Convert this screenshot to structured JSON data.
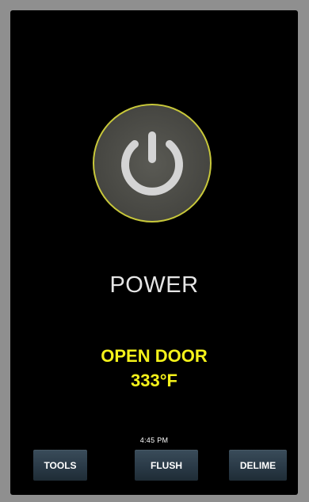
{
  "power": {
    "label": "POWER",
    "icon": "power-icon",
    "ring_color": "#c8c83a"
  },
  "status": {
    "door": "OPEN DOOR",
    "temperature": "333°F",
    "color": "#f4f21a"
  },
  "clock": {
    "time": "4:45 PM"
  },
  "buttons": {
    "tools": "TOOLS",
    "flush": "FLUSH",
    "delime": "DELIME"
  }
}
